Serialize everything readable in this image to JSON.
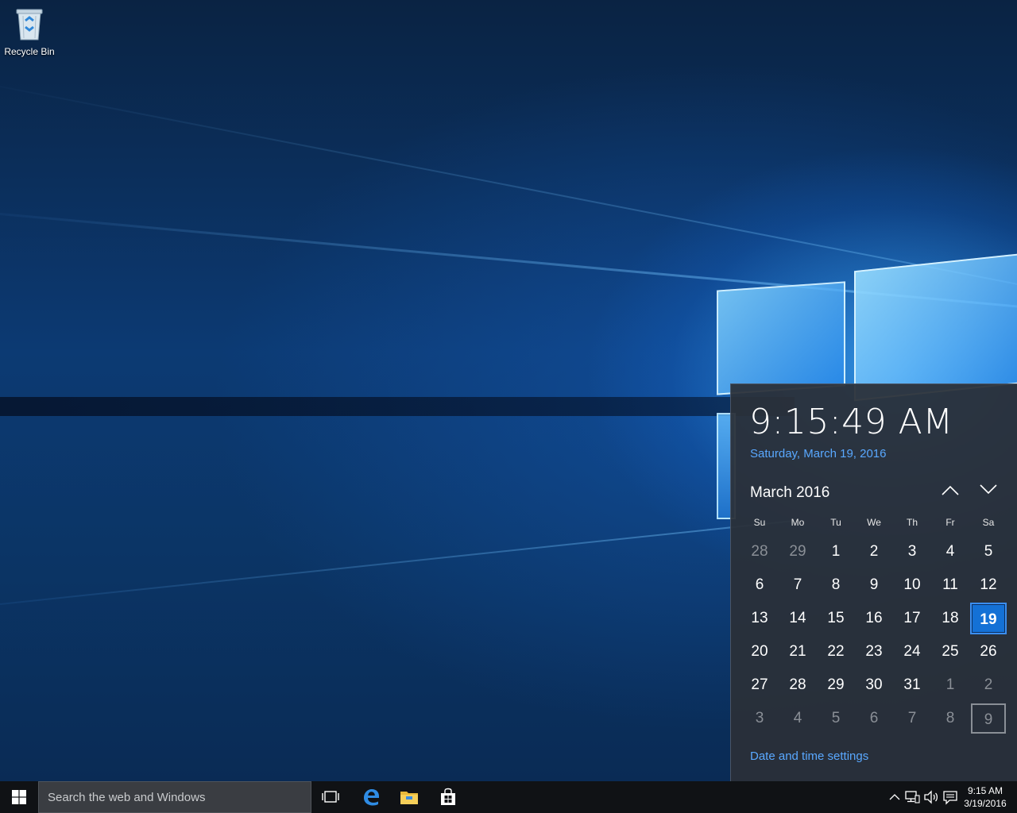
{
  "desktop": {
    "recycle_bin_label": "Recycle Bin"
  },
  "flyout": {
    "time": "9:15:49 AM",
    "long_date": "Saturday, March 19, 2016",
    "month_title": "March 2016",
    "weekdays": [
      "Su",
      "Mo",
      "Tu",
      "We",
      "Th",
      "Fr",
      "Sa"
    ],
    "weeks": [
      [
        {
          "d": "28",
          "other": true
        },
        {
          "d": "29",
          "other": true
        },
        {
          "d": "1"
        },
        {
          "d": "2"
        },
        {
          "d": "3"
        },
        {
          "d": "4"
        },
        {
          "d": "5"
        }
      ],
      [
        {
          "d": "6"
        },
        {
          "d": "7"
        },
        {
          "d": "8"
        },
        {
          "d": "9"
        },
        {
          "d": "10"
        },
        {
          "d": "11"
        },
        {
          "d": "12"
        }
      ],
      [
        {
          "d": "13"
        },
        {
          "d": "14"
        },
        {
          "d": "15"
        },
        {
          "d": "16"
        },
        {
          "d": "17"
        },
        {
          "d": "18"
        },
        {
          "d": "19",
          "today": true
        }
      ],
      [
        {
          "d": "20"
        },
        {
          "d": "21"
        },
        {
          "d": "22"
        },
        {
          "d": "23"
        },
        {
          "d": "24"
        },
        {
          "d": "25"
        },
        {
          "d": "26"
        }
      ],
      [
        {
          "d": "27"
        },
        {
          "d": "28"
        },
        {
          "d": "29"
        },
        {
          "d": "30"
        },
        {
          "d": "31"
        },
        {
          "d": "1",
          "other": true
        },
        {
          "d": "2",
          "other": true
        }
      ],
      [
        {
          "d": "3",
          "other": true
        },
        {
          "d": "4",
          "other": true
        },
        {
          "d": "5",
          "other": true
        },
        {
          "d": "6",
          "other": true
        },
        {
          "d": "7",
          "other": true
        },
        {
          "d": "8",
          "other": true
        },
        {
          "d": "9",
          "other": true,
          "boxed": true
        }
      ]
    ],
    "settings_link": "Date and time settings",
    "accent_color": "#1471d6",
    "link_color": "#59a8ff"
  },
  "taskbar": {
    "search_placeholder": "Search the web and Windows",
    "pinned": [
      "task-view-icon",
      "edge-icon",
      "file-explorer-icon",
      "store-icon"
    ],
    "tray_icons": [
      "chevron-up-icon",
      "network-icon",
      "volume-icon",
      "action-center-icon"
    ],
    "clock_time": "9:15 AM",
    "clock_date": "3/19/2016"
  }
}
